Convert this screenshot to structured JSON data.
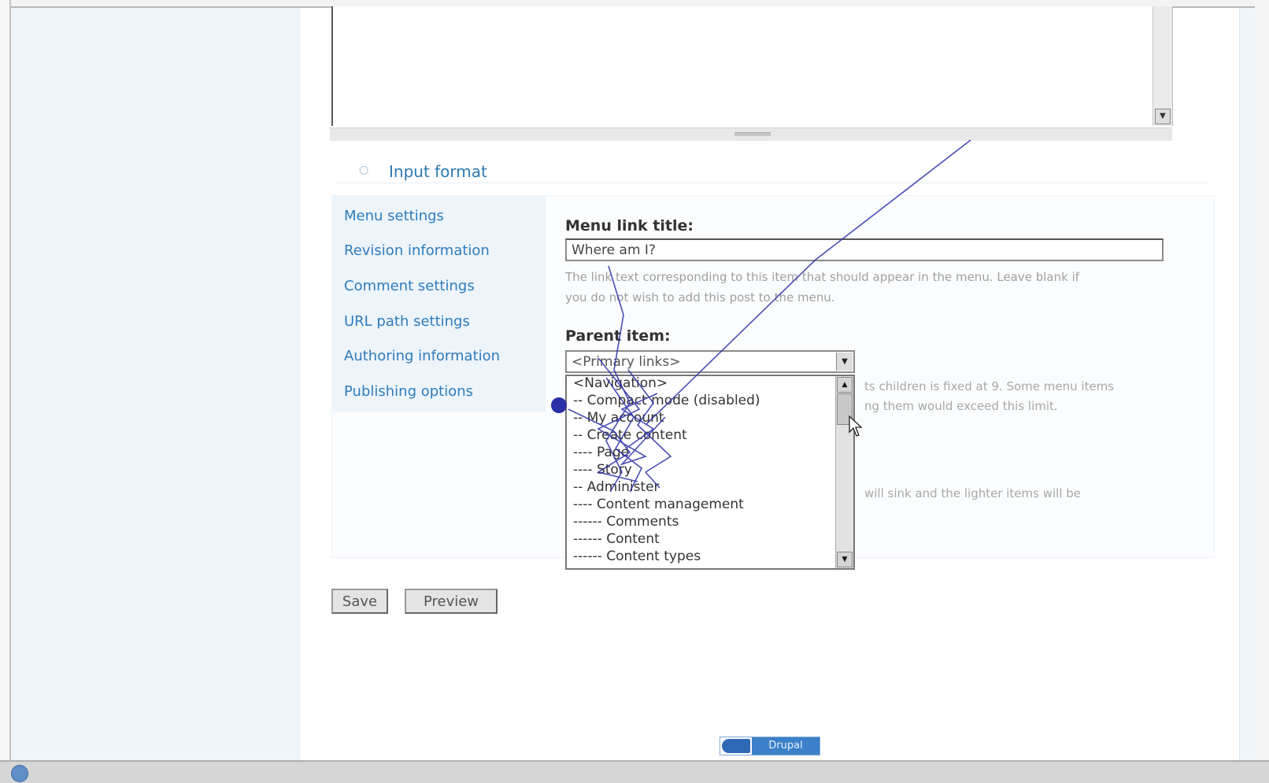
{
  "input_format": {
    "label": "Input format",
    "toggle": "○"
  },
  "vertical_tabs": [
    {
      "label": "Menu settings"
    },
    {
      "label": "Revision information"
    },
    {
      "label": "Comment settings"
    },
    {
      "label": "URL path settings"
    },
    {
      "label": "Authoring information"
    },
    {
      "label": "Publishing options"
    }
  ],
  "menu_settings": {
    "menu_link_title_label": "Menu link title:",
    "menu_link_title_value": "Where am I?",
    "menu_link_title_desc_line1": "The link text corresponding to this item that should appear in the menu. Leave blank if",
    "menu_link_title_desc_line2": "you do not wish to add this post to the menu.",
    "parent_item_label": "Parent item:",
    "parent_item_value": "<Primary links>",
    "parent_desc_visible_line1": "ts children is fixed at 9. Some menu items",
    "parent_desc_visible_line2": "ng them would exceed this limit.",
    "weight_desc_visible": "will sink and the lighter items will be"
  },
  "parent_options": [
    "<Navigation>",
    "-- Compact mode (disabled)",
    "-- My account",
    "-- Create content",
    "---- Page",
    "---- Story",
    "-- Administer",
    "---- Content management",
    "------ Comments",
    "------ Content",
    "------ Content types"
  ],
  "buttons": {
    "save": "Save",
    "preview": "Preview"
  },
  "footer": {
    "badge": "Drupal"
  },
  "colors": {
    "link": "#2f7cbd",
    "gaze": "#2b2fa8",
    "tabs_bg": "#edf4fa",
    "sidebar_bg": "#eef6fc"
  },
  "icons": {
    "textarea_scroll_down": "▼",
    "select_arrow": "▼",
    "scroll_up": "▲",
    "scroll_down": "▼"
  }
}
